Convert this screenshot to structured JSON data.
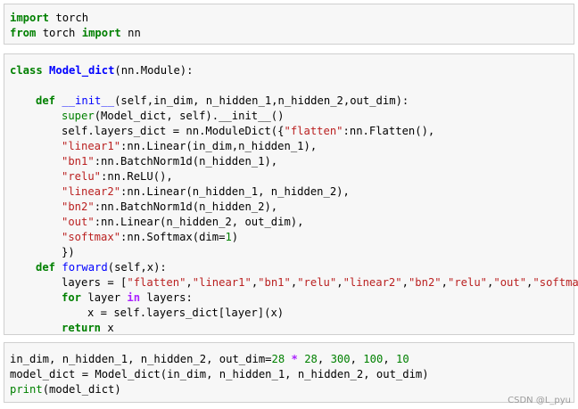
{
  "cells": [
    {
      "lines": [
        [
          {
            "t": "import",
            "c": "kw"
          },
          {
            "t": " torch"
          }
        ],
        [
          {
            "t": "from",
            "c": "kw"
          },
          {
            "t": " torch "
          },
          {
            "t": "import",
            "c": "kw"
          },
          {
            "t": " nn"
          }
        ]
      ]
    },
    {
      "lines": [
        [
          {
            "t": "class",
            "c": "kw"
          },
          {
            "t": " "
          },
          {
            "t": "Model_dict",
            "c": "cls"
          },
          {
            "t": "(nn.Module):"
          }
        ],
        [],
        [
          {
            "t": "def",
            "c": "kw",
            "i": 4
          },
          {
            "t": " "
          },
          {
            "t": "__init__",
            "c": "fn"
          },
          {
            "t": "(self,in_dim, n_hidden_1,n_hidden_2,out_dim):"
          }
        ],
        [
          {
            "t": "super",
            "c": "bi",
            "i": 8
          },
          {
            "t": "(Model_dict, self).__init__()"
          }
        ],
        [
          {
            "t": "self.layers_dict = nn.ModuleDict({",
            "i": 8
          },
          {
            "t": "\"flatten\"",
            "c": "str"
          },
          {
            "t": ":nn.Flatten(),"
          }
        ],
        [
          {
            "t": "\"linear1\"",
            "c": "str",
            "i": 8
          },
          {
            "t": ":nn.Linear(in_dim,n_hidden_1),"
          }
        ],
        [
          {
            "t": "\"bn1\"",
            "c": "str",
            "i": 8
          },
          {
            "t": ":nn.BatchNorm1d(n_hidden_1),"
          }
        ],
        [
          {
            "t": "\"relu\"",
            "c": "str",
            "i": 8
          },
          {
            "t": ":nn.ReLU(),"
          }
        ],
        [
          {
            "t": "\"linear2\"",
            "c": "str",
            "i": 8
          },
          {
            "t": ":nn.Linear(n_hidden_1, n_hidden_2),"
          }
        ],
        [
          {
            "t": "\"bn2\"",
            "c": "str",
            "i": 8
          },
          {
            "t": ":nn.BatchNorm1d(n_hidden_2),"
          }
        ],
        [
          {
            "t": "\"out\"",
            "c": "str",
            "i": 8
          },
          {
            "t": ":nn.Linear(n_hidden_2, out_dim),"
          }
        ],
        [
          {
            "t": "\"softmax\"",
            "c": "str",
            "i": 8
          },
          {
            "t": ":nn.Softmax(dim="
          },
          {
            "t": "1",
            "c": "num"
          },
          {
            "t": ")"
          }
        ],
        [
          {
            "t": "})",
            "i": 8
          }
        ],
        [
          {
            "t": "def",
            "c": "kw",
            "i": 4
          },
          {
            "t": " "
          },
          {
            "t": "forward",
            "c": "fn"
          },
          {
            "t": "(self,x):"
          }
        ],
        [
          {
            "t": "layers = [",
            "i": 8
          },
          {
            "t": "\"flatten\"",
            "c": "str"
          },
          {
            "t": ","
          },
          {
            "t": "\"linear1\"",
            "c": "str"
          },
          {
            "t": ","
          },
          {
            "t": "\"bn1\"",
            "c": "str"
          },
          {
            "t": ","
          },
          {
            "t": "\"relu\"",
            "c": "str"
          },
          {
            "t": ","
          },
          {
            "t": "\"linear2\"",
            "c": "str"
          },
          {
            "t": ","
          },
          {
            "t": "\"bn2\"",
            "c": "str"
          },
          {
            "t": ","
          },
          {
            "t": "\"relu\"",
            "c": "str"
          },
          {
            "t": ","
          },
          {
            "t": "\"out\"",
            "c": "str"
          },
          {
            "t": ","
          },
          {
            "t": "\"softmax\"",
            "c": "str"
          },
          {
            "t": "]"
          }
        ],
        [
          {
            "t": "for",
            "c": "kw",
            "i": 8
          },
          {
            "t": " layer "
          },
          {
            "t": "in",
            "c": "op"
          },
          {
            "t": " layers:"
          }
        ],
        [
          {
            "t": "x = self.layers_dict[layer](x)",
            "i": 12
          }
        ],
        [
          {
            "t": "return",
            "c": "kw",
            "i": 8
          },
          {
            "t": " x"
          }
        ]
      ]
    },
    {
      "lines": [
        [
          {
            "t": "in_dim, n_hidden_1, n_hidden_2, out_dim="
          },
          {
            "t": "28",
            "c": "num"
          },
          {
            "t": " "
          },
          {
            "t": "*",
            "c": "op"
          },
          {
            "t": " "
          },
          {
            "t": "28",
            "c": "num"
          },
          {
            "t": ", "
          },
          {
            "t": "300",
            "c": "num"
          },
          {
            "t": ", "
          },
          {
            "t": "100",
            "c": "num"
          },
          {
            "t": ", "
          },
          {
            "t": "10",
            "c": "num"
          }
        ],
        [
          {
            "t": "model_dict = Model_dict(in_dim, n_hidden_1, n_hidden_2, out_dim)"
          }
        ],
        [
          {
            "t": "print",
            "c": "bi"
          },
          {
            "t": "(model_dict)"
          }
        ]
      ]
    }
  ],
  "watermark": "CSDN @L_pyu",
  "colors": {
    "keyword": "#008000",
    "builtin": "#008000",
    "string": "#ba2121",
    "function_name": "#0000ff",
    "class_name": "#0000ff",
    "number": "#008000",
    "operator": "#aa22ff",
    "cell_background": "#f7f7f7",
    "cell_border": "#cfcfcf"
  }
}
